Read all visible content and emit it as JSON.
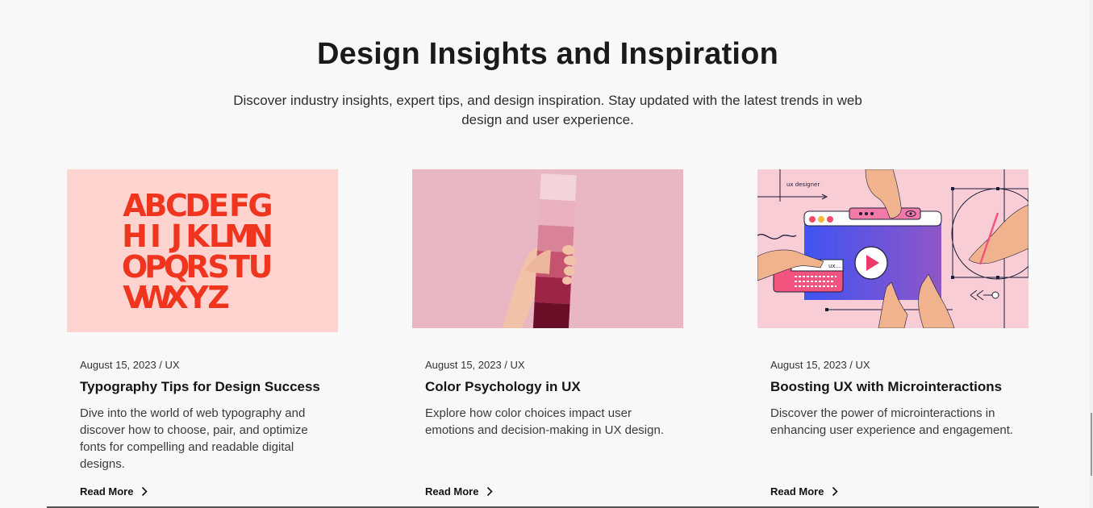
{
  "section": {
    "title": "Design Insights and Inspiration",
    "subtitle": "Discover industry insights, expert tips, and design inspiration. Stay updated with the latest trends in web design and user experience."
  },
  "cards": [
    {
      "meta": "August 15, 2023 / UX",
      "title": "Typography Tips for Design Success",
      "description": "Dive into the world of web typography and discover how to choose, pair, and optimize fonts for compelling and readable digital designs.",
      "cta": "Read More",
      "image": {
        "icon": "alphabet-letters-image",
        "background": "#ffd3cf",
        "ink": "#f0351f",
        "rows": [
          "ABCDEFG",
          "HIJKLMN",
          "OPQRSTU",
          "VWXYZ"
        ]
      }
    },
    {
      "meta": "August 15, 2023 / UX",
      "title": "Color Psychology in UX",
      "description": "Explore how color choices impact user emotions and decision-making in UX design.",
      "cta": "Read More",
      "image": {
        "icon": "color-swatch-hand-image",
        "background": "#e9b6c3"
      }
    },
    {
      "meta": "August 15, 2023 / UX",
      "title": "Boosting UX with Microinteractions",
      "description": "Discover the power of microinteractions in enhancing user experience and engagement.",
      "cta": "Read More",
      "image": {
        "icon": "ux-designer-illustration-image",
        "background": "#f8cdd5",
        "label": "ux designer",
        "chip": "ux..."
      }
    }
  ]
}
